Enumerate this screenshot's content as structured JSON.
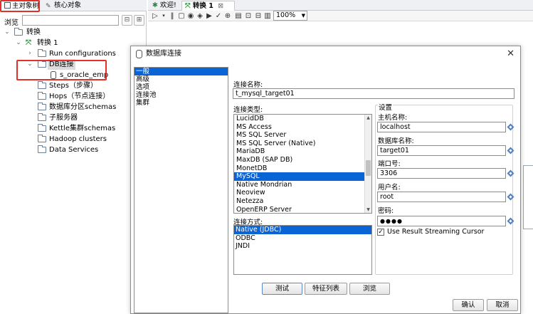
{
  "left_tabs": {
    "active": "主对象树",
    "inactive": "核心对象"
  },
  "search": {
    "label": "浏览",
    "value": ""
  },
  "tree": {
    "root": "转换",
    "transformation": "转换 1",
    "run_configurations": "Run configurations",
    "db_connections": "DB连接",
    "db_item": "s_oracle_emp",
    "steps": "Steps（步骤）",
    "hops": "Hops（节点连接）",
    "partition_schemas": "数据库分区schemas",
    "slave_servers": "子服务器",
    "cluster_schemas": "Kettle集群schemas",
    "hadoop_clusters": "Hadoop clusters",
    "data_services": "Data Services"
  },
  "editor_tabs": {
    "welcome": "欢迎!",
    "transformation": "转换 1"
  },
  "toolbar": {
    "zoom": "100%"
  },
  "dialog": {
    "title": "数据库连接",
    "categories": [
      "一般",
      "高级",
      "选项",
      "连接池",
      "集群"
    ],
    "connection_name_label": "连接名称:",
    "connection_name_value": "t_mysql_target01",
    "connection_type_label": "连接类型:",
    "connection_types": [
      "LucidDB",
      "MS Access",
      "MS SQL Server",
      "MS SQL Server (Native)",
      "MariaDB",
      "MaxDB (SAP DB)",
      "MonetDB",
      "MySQL",
      "Native Mondrian",
      "Neoview",
      "Netezza",
      "OpenERP Server"
    ],
    "selected_type": "MySQL",
    "access_label": "连接方式:",
    "access_methods": [
      "Native (JDBC)",
      "ODBC",
      "JNDI"
    ],
    "selected_access": "Native (JDBC)",
    "settings_label": "设置",
    "host_label": "主机名称:",
    "host_value": "localhost",
    "dbname_label": "数据库名称:",
    "dbname_value": "target01",
    "port_label": "端口号:",
    "port_value": "3306",
    "user_label": "用户名:",
    "user_value": "root",
    "password_label": "密码:",
    "password_value": "●●●●",
    "streaming_label": "Use Result Streaming Cursor",
    "streaming_checked": "✓",
    "test_button": "测试",
    "features_button": "特征列表",
    "explore_button": "浏览",
    "ok_button": "确认",
    "cancel_button": "取消"
  }
}
